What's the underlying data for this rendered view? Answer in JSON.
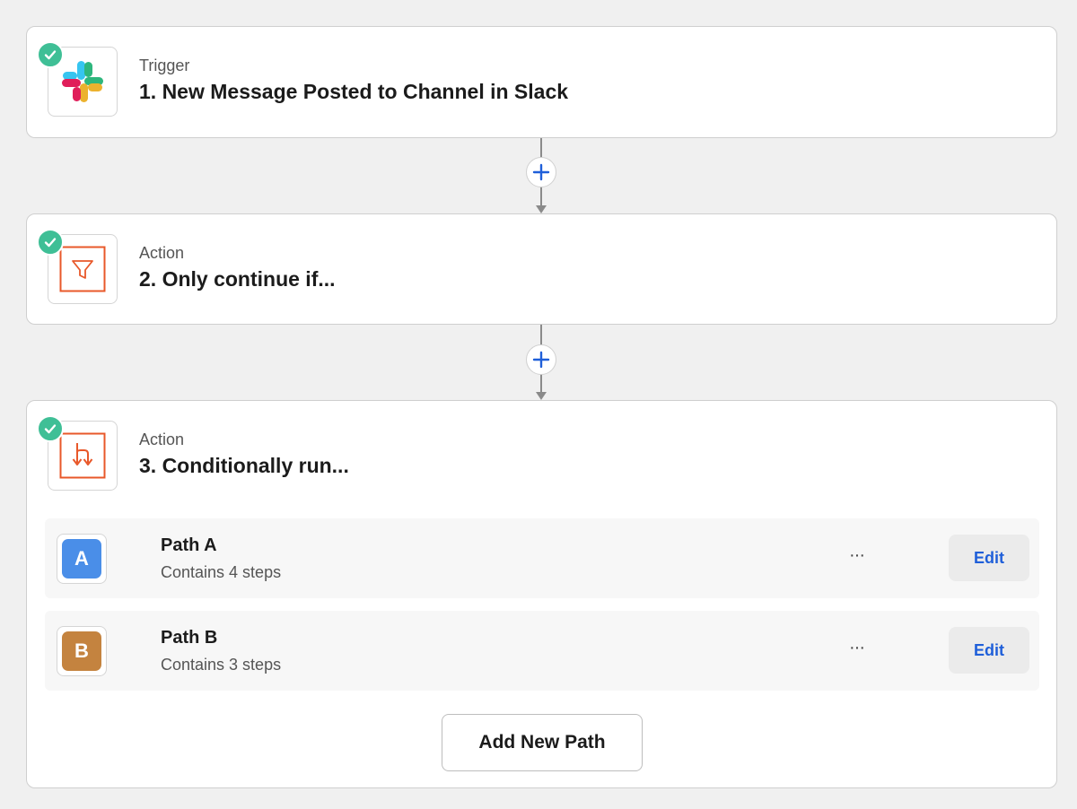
{
  "steps": [
    {
      "type": "Trigger",
      "title": "1. New Message Posted to Channel in Slack",
      "icon": "slack-logo-icon"
    },
    {
      "type": "Action",
      "title": "2. Only continue if...",
      "icon": "filter-icon"
    },
    {
      "type": "Action",
      "title": "3. Conditionally run...",
      "icon": "paths-branch-icon"
    }
  ],
  "paths": [
    {
      "badge": "A",
      "name": "Path A",
      "desc": "Contains 4 steps",
      "color": "#4a8ee8",
      "more": "···",
      "edit": "Edit"
    },
    {
      "badge": "B",
      "name": "Path B",
      "desc": "Contains 3 steps",
      "color": "#c4833f",
      "more": "···",
      "edit": "Edit"
    }
  ],
  "add_path_label": "Add New Path",
  "colors": {
    "check": "#3fbf96",
    "accent_orange": "#e8582a",
    "plus_blue": "#1f5fd9",
    "edit_blue": "#1f5fd9"
  }
}
